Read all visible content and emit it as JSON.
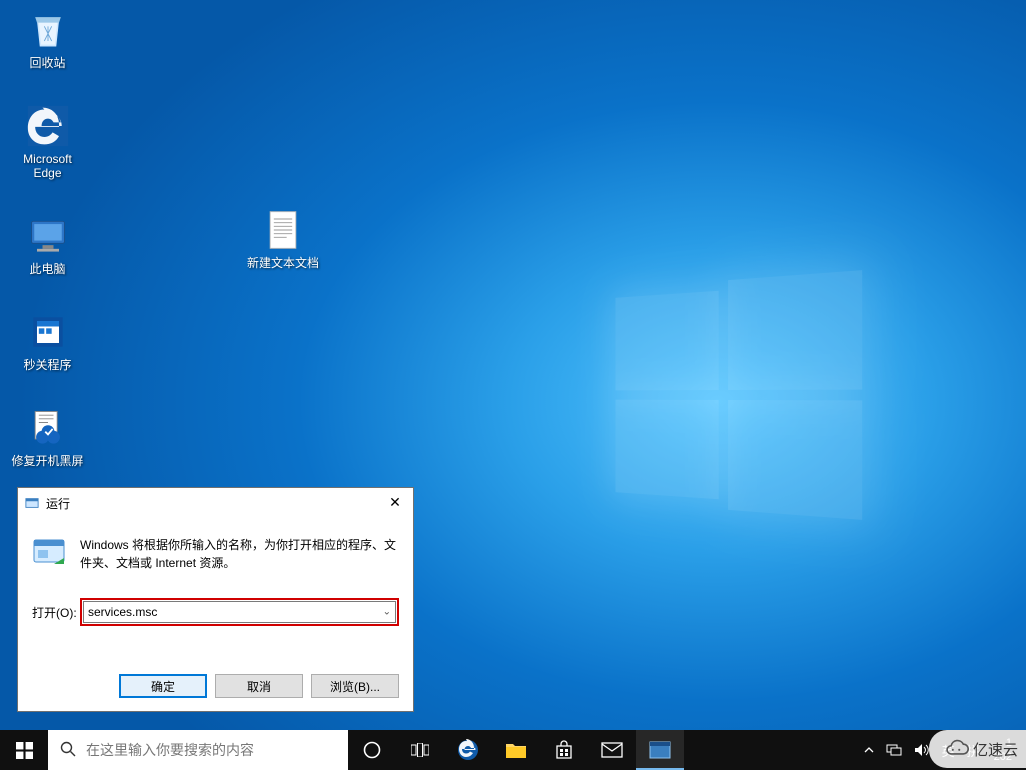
{
  "desktop_icons": {
    "recycle_bin": "回收站",
    "edge": "Microsoft\nEdge",
    "this_pc": "此电脑",
    "tool": "秒关程序",
    "fix": "修复开机黑屏",
    "textdoc": "新建文本文档"
  },
  "run_dialog": {
    "title": "运行",
    "description": "Windows 将根据你所输入的名称，为你打开相应的程序、文件夹、文档或 Internet 资源。",
    "open_label": "打开(O):",
    "open_value": "services.msc",
    "ok_label": "确定",
    "cancel_label": "取消",
    "browse_label": "浏览(B)...",
    "close_glyph": "✕"
  },
  "taskbar": {
    "search_placeholder": "在这里输入你要搜索的内容",
    "ime_text": "英",
    "ime2_text": "拼",
    "clock_time": "1",
    "clock_date": "202"
  },
  "watermark": "亿速云"
}
